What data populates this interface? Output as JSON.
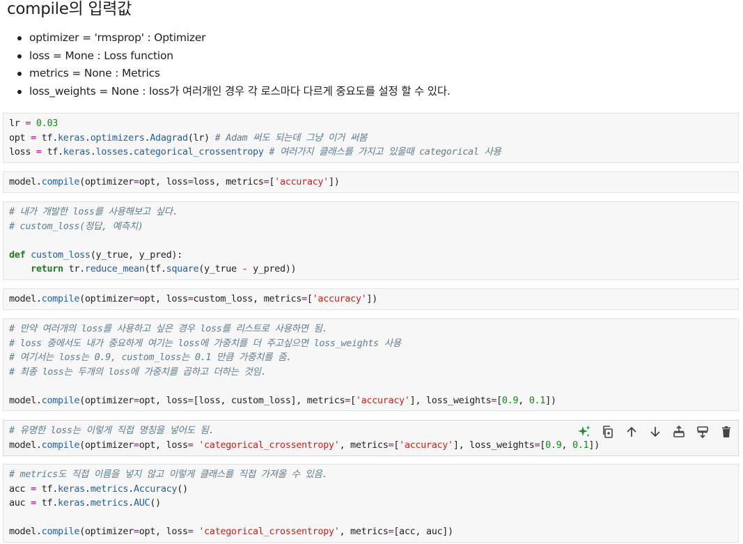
{
  "markdown": {
    "heading": "compile의 입력값",
    "bullets": [
      "optimizer = 'rmsprop' : Optimizer",
      "loss = Mone : Loss function",
      "metrics = None : Metrics",
      "loss_weights = None : loss가 여러개인 경우 각 로스마다 다르게 중요도를 설정 할 수 있다."
    ]
  },
  "cells": [
    {
      "id": "cell-1",
      "lines": [
        [
          [
            "lr ",
            ""
          ],
          [
            "=",
            "op"
          ],
          [
            " ",
            ""
          ],
          [
            "0.03",
            "num"
          ]
        ],
        [
          [
            "opt ",
            ""
          ],
          [
            "=",
            "op"
          ],
          [
            " tf.",
            ""
          ],
          [
            "keras",
            "attr"
          ],
          [
            ".",
            ""
          ],
          [
            "optimizers",
            "attr"
          ],
          [
            ".",
            ""
          ],
          [
            "Adagrad",
            "attr"
          ],
          [
            "(lr) ",
            ""
          ],
          [
            "# Adam 써도 되는데 그냥 이거 써봄",
            "cm"
          ]
        ],
        [
          [
            "loss ",
            ""
          ],
          [
            "=",
            "op"
          ],
          [
            " tf.",
            ""
          ],
          [
            "keras",
            "attr"
          ],
          [
            ".",
            ""
          ],
          [
            "losses",
            "attr"
          ],
          [
            ".",
            ""
          ],
          [
            "categorical_crossentropy",
            "attr"
          ],
          [
            " ",
            ""
          ],
          [
            "# 여러가지 클래스를 가지고 있을때 categorical 사용",
            "cm"
          ]
        ]
      ]
    },
    {
      "id": "cell-2",
      "lines": [
        [
          [
            "model.",
            ""
          ],
          [
            "compile",
            "attr"
          ],
          [
            "(optimizer",
            ""
          ],
          [
            "=",
            "op"
          ],
          [
            "opt, loss",
            ""
          ],
          [
            "=",
            "op"
          ],
          [
            "loss, metrics",
            ""
          ],
          [
            "=",
            "op"
          ],
          [
            "[",
            ""
          ],
          [
            "'accuracy'",
            "str"
          ],
          [
            "])",
            ""
          ]
        ]
      ]
    },
    {
      "id": "cell-3",
      "lines": [
        [
          [
            "# 내가 개발한 loss를 사용해보고 싶다.",
            "cm"
          ]
        ],
        [
          [
            "# custom_loss(정답, 예측치)",
            "cm"
          ]
        ],
        [],
        [
          [
            "def",
            "kw"
          ],
          [
            " ",
            ""
          ],
          [
            "custom_loss",
            "fn"
          ],
          [
            "(y_true, y_pred):",
            ""
          ]
        ],
        [
          [
            "    ",
            ""
          ],
          [
            "return",
            "kw"
          ],
          [
            " tr.",
            ""
          ],
          [
            "reduce_mean",
            "attr"
          ],
          [
            "(tf.",
            ""
          ],
          [
            "square",
            "attr"
          ],
          [
            "(y_true ",
            ""
          ],
          [
            "-",
            "op"
          ],
          [
            " y_pred))",
            ""
          ]
        ]
      ]
    },
    {
      "id": "cell-4",
      "lines": [
        [
          [
            "model.",
            ""
          ],
          [
            "compile",
            "attr"
          ],
          [
            "(optimizer",
            ""
          ],
          [
            "=",
            "op"
          ],
          [
            "opt, loss",
            ""
          ],
          [
            "=",
            "op"
          ],
          [
            "custom_loss, metrics",
            ""
          ],
          [
            "=",
            "op"
          ],
          [
            "[",
            ""
          ],
          [
            "'accuracy'",
            "str"
          ],
          [
            "])",
            ""
          ]
        ]
      ]
    },
    {
      "id": "cell-5",
      "lines": [
        [
          [
            "# 만약 여러개의 loss를 사용하고 싶은 경우 loss를 리스트로 사용하면 됨.",
            "cm"
          ]
        ],
        [
          [
            "# loss 중에서도 내가 중요하게 여기는 loss에 가중치를 더 주고싶으면 loss_weights 사용",
            "cm"
          ]
        ],
        [
          [
            "# 여기서는 loss는 0.9, custom_loss는 0.1 만큼 가중치를 줌.",
            "cm"
          ]
        ],
        [
          [
            "# 최종 loss는 두개의 loss에 가중치를 곱하고 더하는 것임.",
            "cm"
          ]
        ],
        [],
        [
          [
            "model.",
            ""
          ],
          [
            "compile",
            "attr"
          ],
          [
            "(optimizer",
            ""
          ],
          [
            "=",
            "op"
          ],
          [
            "opt, loss",
            ""
          ],
          [
            "=",
            "op"
          ],
          [
            "[loss, custom_loss], metrics",
            ""
          ],
          [
            "=",
            "op"
          ],
          [
            "[",
            ""
          ],
          [
            "'accuracy'",
            "str"
          ],
          [
            "], loss_weights",
            ""
          ],
          [
            "=",
            "op"
          ],
          [
            "[",
            ""
          ],
          [
            "0.9",
            "num"
          ],
          [
            ", ",
            ""
          ],
          [
            "0.1",
            "num"
          ],
          [
            "])",
            ""
          ]
        ]
      ]
    },
    {
      "id": "cell-6",
      "active": true,
      "lines": [
        [
          [
            "# 유명한 loss는 이렇게 직접 명칭을 넣어도 됨.",
            "cm"
          ]
        ],
        [
          [
            "model.",
            ""
          ],
          [
            "compile",
            "attr"
          ],
          [
            "(optimizer",
            ""
          ],
          [
            "=",
            "op"
          ],
          [
            "opt, loss",
            ""
          ],
          [
            "=",
            "op"
          ],
          [
            " ",
            ""
          ],
          [
            "'categorical_crossentropy'",
            "str"
          ],
          [
            ", metrics",
            ""
          ],
          [
            "=",
            "op"
          ],
          [
            "[",
            ""
          ],
          [
            "'accuracy'",
            "str"
          ],
          [
            "], loss_weights",
            ""
          ],
          [
            "=",
            "op"
          ],
          [
            "[",
            ""
          ],
          [
            "0.9",
            "num"
          ],
          [
            ", ",
            ""
          ],
          [
            "0.1",
            "num"
          ],
          [
            "])",
            ""
          ]
        ]
      ]
    },
    {
      "id": "cell-7",
      "lines": [
        [
          [
            "# metrics도 직접 이름을 넣지 않고 이렇게 클래스를 직접 가져올 수 있음.",
            "cm"
          ]
        ],
        [
          [
            "acc ",
            ""
          ],
          [
            "=",
            "op"
          ],
          [
            " tf.",
            ""
          ],
          [
            "keras",
            "attr"
          ],
          [
            ".",
            ""
          ],
          [
            "metrics",
            "attr"
          ],
          [
            ".",
            ""
          ],
          [
            "Accuracy",
            "attr"
          ],
          [
            "()",
            ""
          ]
        ],
        [
          [
            "auc ",
            ""
          ],
          [
            "=",
            "op"
          ],
          [
            " tf.",
            ""
          ],
          [
            "keras",
            "attr"
          ],
          [
            ".",
            ""
          ],
          [
            "metrics",
            "attr"
          ],
          [
            ".",
            ""
          ],
          [
            "AUC",
            "attr"
          ],
          [
            "()",
            ""
          ]
        ],
        [],
        [
          [
            "model.",
            ""
          ],
          [
            "compile",
            "attr"
          ],
          [
            "(optimizer",
            ""
          ],
          [
            "=",
            "op"
          ],
          [
            "opt, loss",
            ""
          ],
          [
            "=",
            "op"
          ],
          [
            " ",
            ""
          ],
          [
            "'categorical_crossentropy'",
            "str"
          ],
          [
            ", metrics",
            ""
          ],
          [
            "=",
            "op"
          ],
          [
            "[acc, auc])",
            ""
          ]
        ]
      ]
    }
  ],
  "toolbar": {
    "buttons": [
      "sparkle-ai-icon",
      "copy-cell-icon",
      "move-up-icon",
      "move-down-icon",
      "add-cell-above-icon",
      "add-cell-below-icon",
      "delete-icon"
    ],
    "accent": "#1a8c3a"
  }
}
